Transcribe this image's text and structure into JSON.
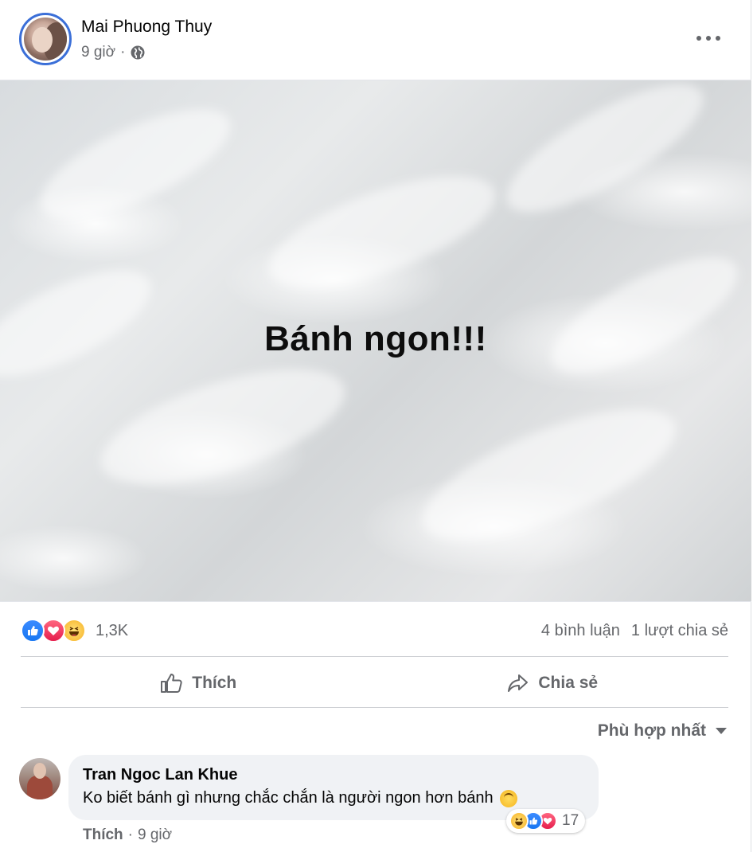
{
  "post": {
    "author": "Mai Phuong Thuy",
    "time": "9 giờ",
    "separator": "·",
    "privacy_icon": "globe-icon",
    "more_icon": "more-options-icon",
    "image_text": "Bánh ngon!!!"
  },
  "stats": {
    "reaction_icons": [
      "like-reaction-icon",
      "love-reaction-icon",
      "haha-reaction-icon"
    ],
    "reaction_count": "1,3K",
    "comments": "4 bình luận",
    "shares": "1 lượt chia sẻ"
  },
  "actions": {
    "like_label": "Thích",
    "share_label": "Chia sẻ"
  },
  "sort": {
    "label": "Phù hợp nhất"
  },
  "comment": {
    "author": "Tran Ngoc Lan Khue",
    "text": "Ko biết bánh gì nhưng chắc chắn là người ngon hơn bánh",
    "emoji": "upside-down-face",
    "reaction_icons": [
      "haha-reaction-icon",
      "like-reaction-icon",
      "love-reaction-icon"
    ],
    "reaction_count": "17",
    "like_label": "Thích",
    "separator": "·",
    "time": "9 giờ"
  },
  "colors": {
    "accent": "#1877f2",
    "love": "#e61e4d",
    "haha": "#f7b125",
    "secondary_text": "#65676b",
    "bubble_bg": "#f0f2f5"
  }
}
